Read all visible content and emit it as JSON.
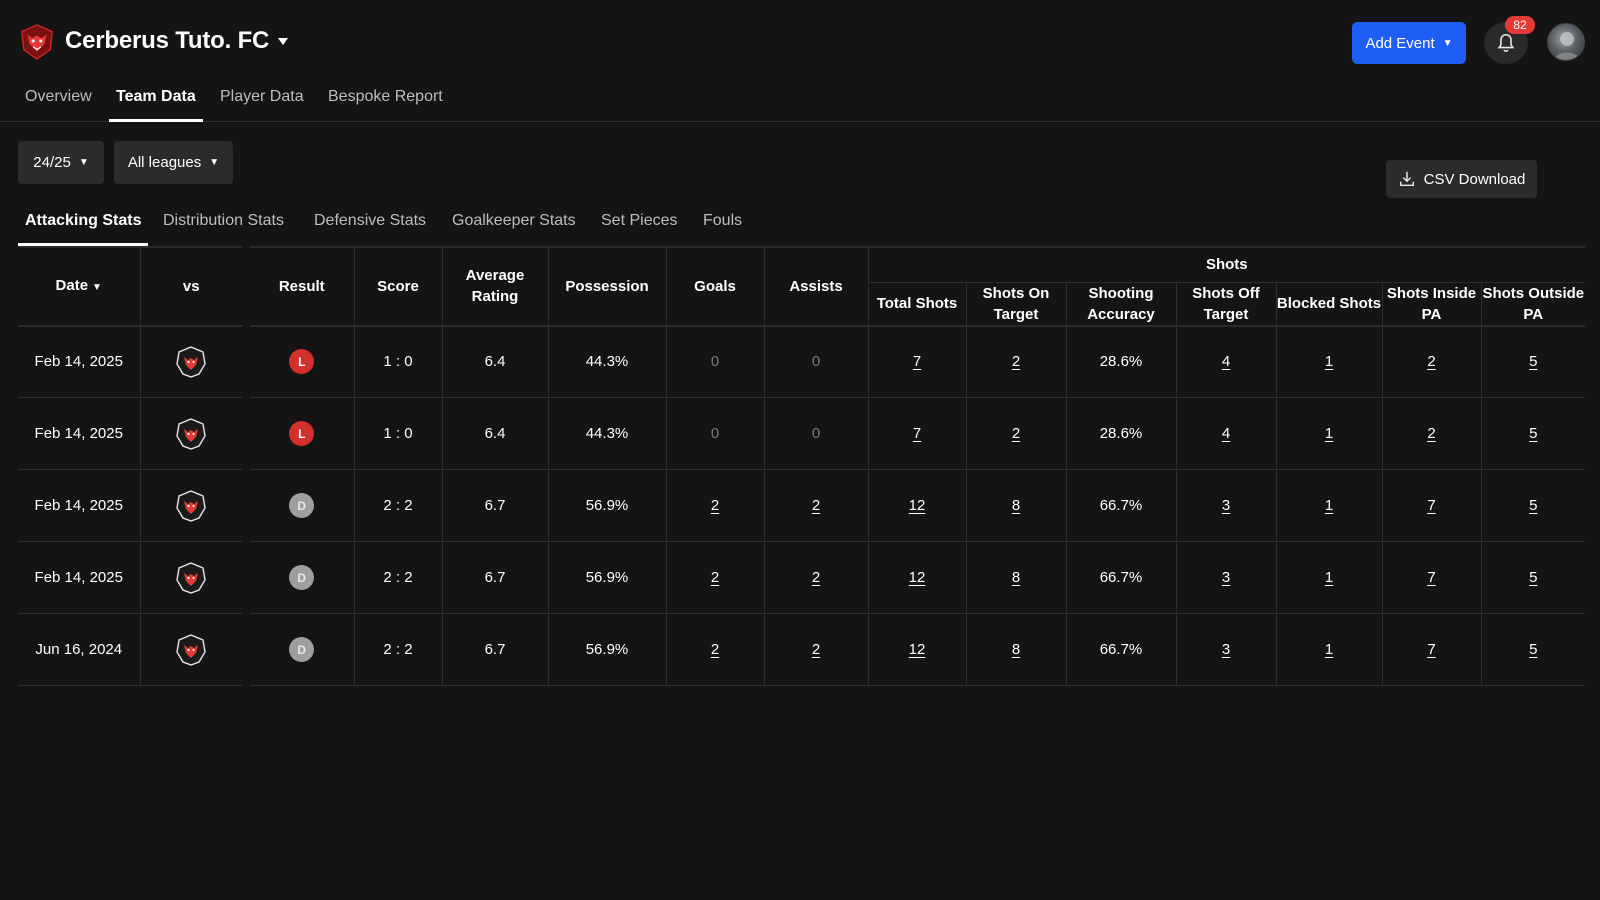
{
  "header": {
    "club_name": "Cerberus Tuto. FC",
    "add_event_label": "Add Event",
    "notification_count": "82",
    "accent_color": "#1f5ef5"
  },
  "main_tabs": [
    {
      "label": "Overview",
      "active": false
    },
    {
      "label": "Team Data",
      "active": true
    },
    {
      "label": "Player Data",
      "active": false
    },
    {
      "label": "Bespoke Report",
      "active": false
    }
  ],
  "filters": {
    "season": "24/25",
    "league": "All leagues"
  },
  "csv_label": "CSV Download",
  "sub_tabs": [
    {
      "label": "Attacking Stats",
      "active": true
    },
    {
      "label": "Distribution Stats",
      "active": false
    },
    {
      "label": "Defensive Stats",
      "active": false
    },
    {
      "label": "Goalkeeper Stats",
      "active": false
    },
    {
      "label": "Set Pieces",
      "active": false
    },
    {
      "label": "Fouls",
      "active": false
    }
  ],
  "table": {
    "group_header": "Shots",
    "headers": {
      "date": "Date",
      "vs": "vs",
      "result": "Result",
      "score": "Score",
      "avg_rating": "Average Rating",
      "possession": "Possession",
      "goals": "Goals",
      "assists": "Assists",
      "total_shots": "Total Shots",
      "shots_on_target": "Shots On Target",
      "shooting_accuracy": "Shooting Accuracy",
      "shots_off_target": "Shots Off Target",
      "blocked_shots": "Blocked Shots",
      "shots_inside_pa": "Shots Inside PA",
      "shots_outside_pa": "Shots Outside PA"
    },
    "rows": [
      {
        "date": "Feb 14, 2025",
        "result": "L",
        "score": "1 : 0",
        "avg_rating": "6.4",
        "possession": "44.3%",
        "goals": "0",
        "assists": "0",
        "total_shots": "7",
        "shots_on_target": "2",
        "shooting_accuracy": "28.6%",
        "shots_off_target": "4",
        "blocked_shots": "1",
        "shots_inside_pa": "2",
        "shots_outside_pa": "5"
      },
      {
        "date": "Feb 14, 2025",
        "result": "L",
        "score": "1 : 0",
        "avg_rating": "6.4",
        "possession": "44.3%",
        "goals": "0",
        "assists": "0",
        "total_shots": "7",
        "shots_on_target": "2",
        "shooting_accuracy": "28.6%",
        "shots_off_target": "4",
        "blocked_shots": "1",
        "shots_inside_pa": "2",
        "shots_outside_pa": "5"
      },
      {
        "date": "Feb 14, 2025",
        "result": "D",
        "score": "2 : 2",
        "avg_rating": "6.7",
        "possession": "56.9%",
        "goals": "2",
        "assists": "2",
        "total_shots": "12",
        "shots_on_target": "8",
        "shooting_accuracy": "66.7%",
        "shots_off_target": "3",
        "blocked_shots": "1",
        "shots_inside_pa": "7",
        "shots_outside_pa": "5"
      },
      {
        "date": "Feb 14, 2025",
        "result": "D",
        "score": "2 : 2",
        "avg_rating": "6.7",
        "possession": "56.9%",
        "goals": "2",
        "assists": "2",
        "total_shots": "12",
        "shots_on_target": "8",
        "shooting_accuracy": "66.7%",
        "shots_off_target": "3",
        "blocked_shots": "1",
        "shots_inside_pa": "7",
        "shots_outside_pa": "5"
      },
      {
        "date": "Jun 16, 2024",
        "result": "D",
        "score": "2 : 2",
        "avg_rating": "6.7",
        "possession": "56.9%",
        "goals": "2",
        "assists": "2",
        "total_shots": "12",
        "shots_on_target": "8",
        "shooting_accuracy": "66.7%",
        "shots_off_target": "3",
        "blocked_shots": "1",
        "shots_inside_pa": "7",
        "shots_outside_pa": "5"
      }
    ]
  }
}
